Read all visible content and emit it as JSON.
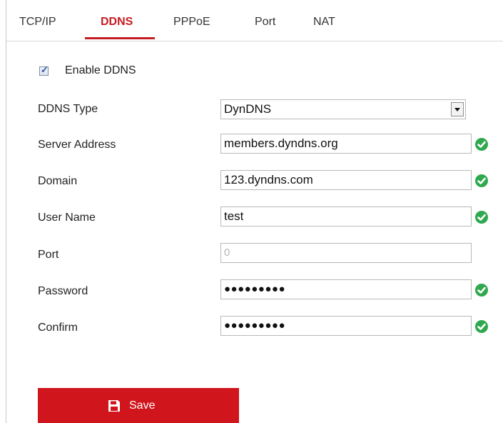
{
  "tabs": [
    {
      "label": "TCP/IP"
    },
    {
      "label": "DDNS"
    },
    {
      "label": "PPPoE"
    },
    {
      "label": "Port"
    },
    {
      "label": "NAT"
    }
  ],
  "form": {
    "enable_label": "Enable DDNS",
    "enable_checked": true,
    "fields": {
      "ddns_type": {
        "label": "DDNS Type",
        "value": "DynDNS"
      },
      "server_address": {
        "label": "Server Address",
        "value": "members.dyndns.org"
      },
      "domain": {
        "label": "Domain",
        "value": "123.dyndns.com"
      },
      "user_name": {
        "label": "User Name",
        "value": "test"
      },
      "port": {
        "label": "Port",
        "value": "0"
      },
      "password": {
        "label": "Password",
        "value": "●●●●●●●●●"
      },
      "confirm": {
        "label": "Confirm",
        "value": "●●●●●●●●●"
      }
    }
  },
  "save_label": "Save",
  "colors": {
    "accent": "#c61d23",
    "button": "#d0151d",
    "valid": "#2fa84f"
  },
  "icons": {
    "valid": "check-circle-icon",
    "save": "floppy-disk-icon",
    "dropdown": "chevron-down-icon"
  }
}
